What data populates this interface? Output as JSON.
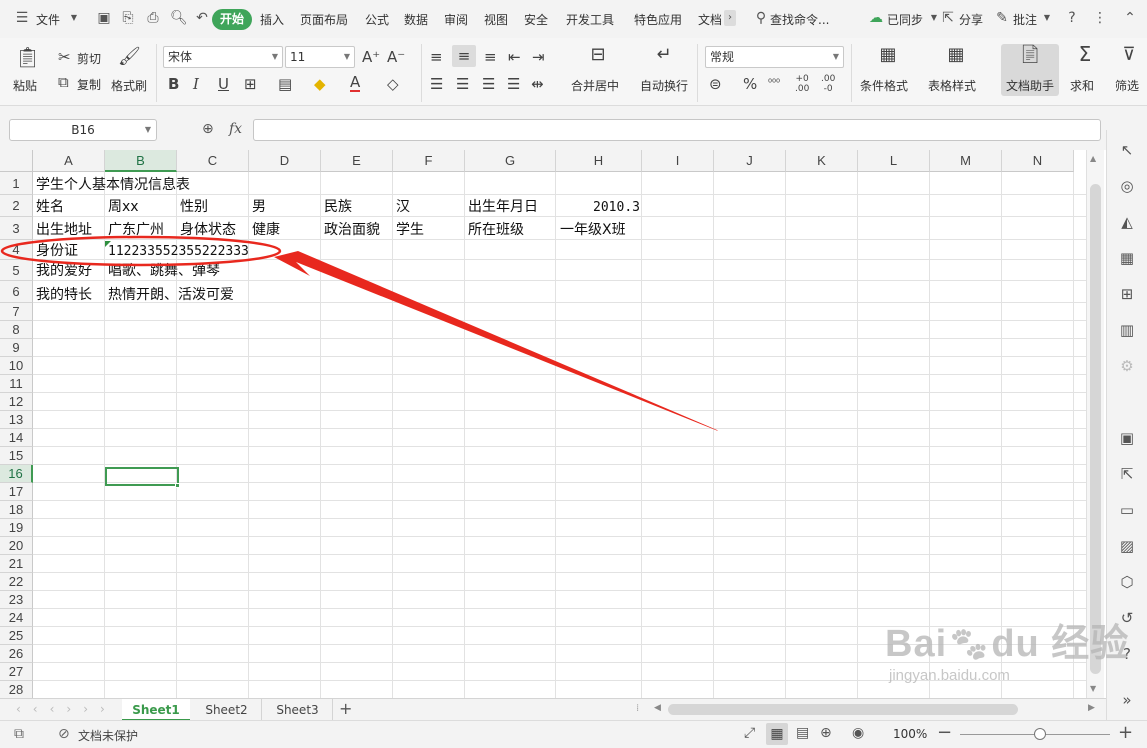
{
  "menu": {
    "file": "文件",
    "tabs": [
      "开始",
      "插入",
      "页面布局",
      "公式",
      "数据",
      "审阅",
      "视图",
      "安全",
      "开发工具",
      "特色应用",
      "文档"
    ],
    "search": "查找命令...",
    "sync": "已同步",
    "share": "分享",
    "comment": "批注"
  },
  "ribbon": {
    "paste": "粘贴",
    "cut": "剪切",
    "copy": "复制",
    "format_painter": "格式刷",
    "font_name": "宋体",
    "font_size": "11",
    "merge_center": "合并居中",
    "wrap_text": "自动换行",
    "number_format": "常规",
    "conditional_format": "条件格式",
    "table_style": "表格样式",
    "doc_assistant": "文档助手",
    "sum": "求和",
    "filter": "筛选"
  },
  "formula_bar": {
    "cell_ref": "B16",
    "fx": "fx",
    "value": ""
  },
  "columns": [
    "A",
    "B",
    "C",
    "D",
    "E",
    "F",
    "G",
    "H",
    "I",
    "J",
    "K",
    "L",
    "M",
    "N"
  ],
  "rows": [
    "1",
    "2",
    "3",
    "4",
    "5",
    "6",
    "7",
    "8",
    "9",
    "10",
    "11",
    "12",
    "13",
    "14",
    "15",
    "16",
    "17",
    "18",
    "19",
    "20",
    "21",
    "22",
    "23",
    "24",
    "25",
    "26",
    "27",
    "28"
  ],
  "cells": {
    "A1": "学生个人基本情况信息表",
    "A2": "姓名",
    "B2": "周xx",
    "C2": "性别",
    "D2": "男",
    "E2": "民族",
    "F2": "汉",
    "G2": "出生年月日",
    "H2": "2010.3",
    "A3": "出生地址",
    "B3": "广东广州",
    "C3": "身体状态",
    "D3": "健康",
    "E3": "政治面貌",
    "F3": "学生",
    "G3": "所在班级",
    "H3": "一年级X班",
    "A4": "身份证",
    "B4": "112233552355222333",
    "A5": "我的爱好",
    "B5": "唱歌、跳舞、弹琴",
    "A6": "我的特长",
    "B6": "热情开朗、活泼可爱"
  },
  "selected_cell": "B16",
  "sheets": [
    "Sheet1",
    "Sheet2",
    "Sheet3"
  ],
  "active_sheet": "Sheet1",
  "status": {
    "protect": "文档未保护",
    "zoom": "100%"
  },
  "watermark": {
    "logo": "Bai du 经验",
    "url": "jingyan.baidu.com"
  },
  "annotation_color": "#e8281e",
  "accent_color": "#3fa55a"
}
